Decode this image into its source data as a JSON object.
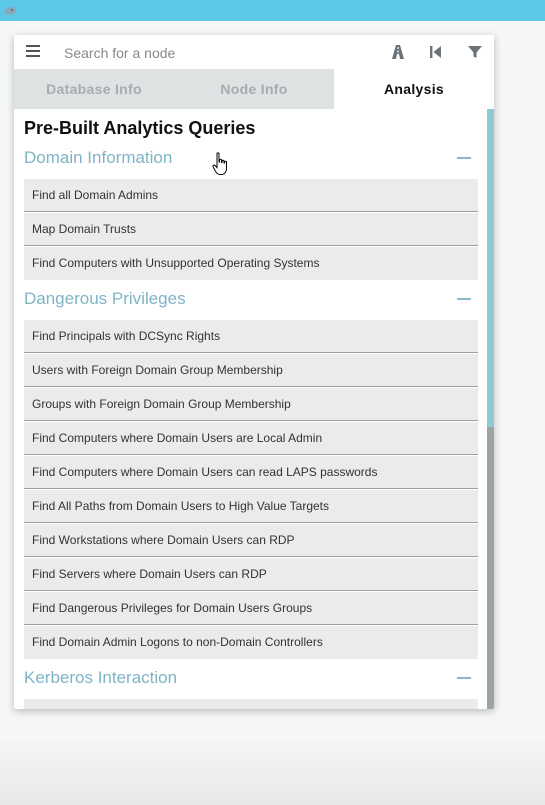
{
  "search": {
    "placeholder": "Search for a node"
  },
  "tabs": [
    {
      "label": "Database Info",
      "active": false
    },
    {
      "label": "Node Info",
      "active": false
    },
    {
      "label": "Analysis",
      "active": true
    }
  ],
  "analysis": {
    "heading": "Pre-Built Analytics Queries",
    "sections": [
      {
        "title": "Domain Information",
        "items": [
          "Find all Domain Admins",
          "Map Domain Trusts",
          "Find Computers with Unsupported Operating Systems"
        ]
      },
      {
        "title": "Dangerous Privileges",
        "items": [
          "Find Principals with DCSync Rights",
          "Users with Foreign Domain Group Membership",
          "Groups with Foreign Domain Group Membership",
          "Find Computers where Domain Users are Local Admin",
          "Find Computers where Domain Users can read LAPS passwords",
          "Find All Paths from Domain Users to High Value Targets",
          "Find Workstations where Domain Users can RDP",
          "Find Servers where Domain Users can RDP",
          "Find Dangerous Privileges for Domain Users Groups",
          "Find Domain Admin Logons to non-Domain Controllers"
        ]
      },
      {
        "title": "Kerberos Interaction",
        "items": [
          ""
        ]
      }
    ]
  },
  "colors": {
    "accent": "#5bc8e8",
    "section_title": "#7fb4c6",
    "tab_inactive_bg": "#dfe2e2",
    "item_bg": "#ebebeb"
  },
  "icons": [
    "app-logo-icon",
    "hamburger-menu-icon",
    "pathfinding-icon",
    "back-icon",
    "filter-icon",
    "mouse-pointer-icon"
  ]
}
